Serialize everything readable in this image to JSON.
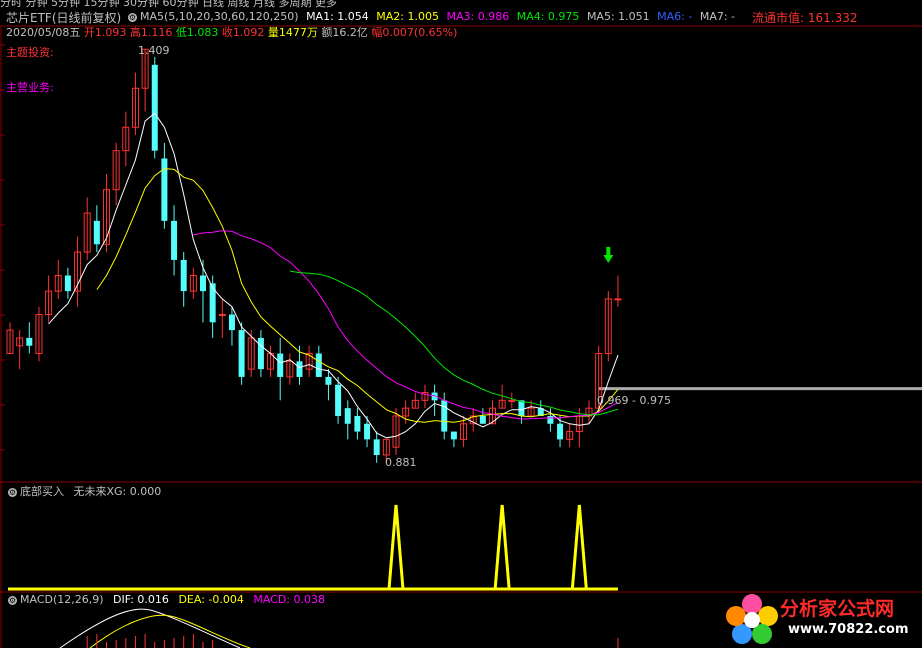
{
  "top_tabs": "分时 分钟 5分钟 15分钟 30分钟 60分钟 日线 周线 月线 多周期 更多",
  "title": "芯片ETF(日线前复权)",
  "ma_header": {
    "label": "MA5(5,10,20,30,60,120,250)",
    "ma1": "MA1: 1.054",
    "ma2": "MA2: 1.005",
    "ma3": "MA3: 0.986",
    "ma4": "MA4: 0.975",
    "ma5": "MA5: 1.051",
    "ma6": "MA6: -",
    "ma7": "MA7: -"
  },
  "float_cap": "流通市值: 161.332",
  "quote": {
    "date": "2020/05/08五",
    "open_lbl": "开",
    "open": "1.093",
    "high_lbl": "高",
    "high": "1.116",
    "low_lbl": "低",
    "low": "1.083",
    "close_lbl": "收",
    "close": "1.092",
    "vol_lbl": "量",
    "vol": "1477万",
    "amt_lbl": "额",
    "amt": "16.2亿",
    "chg_lbl": "幅",
    "chg": "0.007(0.65%)"
  },
  "theme_label": "主题投资:",
  "business_label": "主营业务:",
  "max_label": "1.409",
  "min_label": "0.881",
  "range_label": "0.969 - 0.975",
  "panel2": {
    "title": "底部买入",
    "sub": "无未来XG: 0.000"
  },
  "panel3": {
    "title": "MACD(12,26,9)",
    "dif": "DIF: 0.016",
    "dea": "DEA: -0.004",
    "macd": "MACD: 0.038"
  },
  "watermark": {
    "name": "分析家公式网",
    "url": "www.70822.com"
  },
  "colors": {
    "up": "#ff3232",
    "down": "#54fcfc",
    "ma1": "#ffffff",
    "ma2": "#ffff00",
    "ma3": "#ff00ff",
    "ma4": "#00e600",
    "signal": "#ffff00"
  },
  "chart_data": {
    "type": "candlestick",
    "series": "daily",
    "price_range": [
      0.881,
      1.409
    ],
    "candles": [
      [
        1.02,
        1.05,
        1.02,
        1.06
      ],
      [
        1.03,
        1.04,
        1.0,
        1.05
      ],
      [
        1.04,
        1.03,
        1.02,
        1.06
      ],
      [
        1.02,
        1.07,
        1.01,
        1.08
      ],
      [
        1.07,
        1.1,
        1.06,
        1.12
      ],
      [
        1.1,
        1.12,
        1.09,
        1.14
      ],
      [
        1.12,
        1.1,
        1.09,
        1.13
      ],
      [
        1.1,
        1.15,
        1.08,
        1.17
      ],
      [
        1.15,
        1.2,
        1.14,
        1.22
      ],
      [
        1.19,
        1.16,
        1.15,
        1.21
      ],
      [
        1.16,
        1.23,
        1.15,
        1.25
      ],
      [
        1.23,
        1.28,
        1.21,
        1.29
      ],
      [
        1.28,
        1.31,
        1.26,
        1.33
      ],
      [
        1.31,
        1.36,
        1.3,
        1.38
      ],
      [
        1.36,
        1.41,
        1.33,
        1.41
      ],
      [
        1.39,
        1.28,
        1.27,
        1.4
      ],
      [
        1.27,
        1.19,
        1.18,
        1.29
      ],
      [
        1.19,
        1.14,
        1.12,
        1.21
      ],
      [
        1.14,
        1.1,
        1.08,
        1.15
      ],
      [
        1.1,
        1.12,
        1.09,
        1.13
      ],
      [
        1.12,
        1.1,
        1.06,
        1.14
      ],
      [
        1.11,
        1.06,
        1.04,
        1.12
      ],
      [
        1.07,
        1.07,
        1.04,
        1.09
      ],
      [
        1.07,
        1.05,
        1.03,
        1.08
      ],
      [
        1.05,
        0.99,
        0.98,
        1.06
      ],
      [
        1.0,
        1.04,
        0.99,
        1.05
      ],
      [
        1.04,
        1.0,
        0.99,
        1.05
      ],
      [
        1.0,
        1.02,
        0.99,
        1.03
      ],
      [
        1.02,
        0.99,
        0.96,
        1.04
      ],
      [
        0.99,
        1.01,
        0.98,
        1.02
      ],
      [
        1.01,
        0.99,
        0.98,
        1.03
      ],
      [
        1.0,
        1.02,
        0.99,
        1.03
      ],
      [
        1.02,
        0.99,
        0.99,
        1.03
      ],
      [
        0.99,
        0.98,
        0.96,
        1.0
      ],
      [
        0.98,
        0.94,
        0.93,
        0.99
      ],
      [
        0.95,
        0.93,
        0.91,
        0.96
      ],
      [
        0.94,
        0.92,
        0.91,
        0.95
      ],
      [
        0.93,
        0.91,
        0.9,
        0.94
      ],
      [
        0.91,
        0.89,
        0.88,
        0.92
      ],
      [
        0.89,
        0.91,
        0.88,
        0.91
      ],
      [
        0.9,
        0.94,
        0.89,
        0.95
      ],
      [
        0.94,
        0.95,
        0.93,
        0.96
      ],
      [
        0.95,
        0.96,
        0.95,
        0.97
      ],
      [
        0.96,
        0.97,
        0.95,
        0.98
      ],
      [
        0.97,
        0.96,
        0.94,
        0.98
      ],
      [
        0.96,
        0.92,
        0.91,
        0.97
      ],
      [
        0.92,
        0.91,
        0.9,
        0.92
      ],
      [
        0.91,
        0.93,
        0.9,
        0.94
      ],
      [
        0.93,
        0.94,
        0.92,
        0.95
      ],
      [
        0.94,
        0.93,
        0.93,
        0.95
      ],
      [
        0.93,
        0.95,
        0.93,
        0.96
      ],
      [
        0.95,
        0.96,
        0.95,
        0.98
      ],
      [
        0.96,
        0.96,
        0.95,
        0.97
      ],
      [
        0.96,
        0.94,
        0.93,
        0.96
      ],
      [
        0.94,
        0.95,
        0.94,
        0.96
      ],
      [
        0.95,
        0.94,
        0.94,
        0.96
      ],
      [
        0.94,
        0.93,
        0.92,
        0.95
      ],
      [
        0.93,
        0.91,
        0.9,
        0.94
      ],
      [
        0.91,
        0.92,
        0.9,
        0.93
      ],
      [
        0.92,
        0.94,
        0.9,
        0.95
      ],
      [
        0.94,
        0.95,
        0.93,
        0.96
      ],
      [
        0.95,
        1.02,
        0.95,
        1.03
      ],
      [
        1.02,
        1.09,
        1.01,
        1.1
      ],
      [
        1.09,
        1.09,
        1.08,
        1.12
      ]
    ],
    "signal_peaks": [
      40,
      51,
      59
    ]
  }
}
